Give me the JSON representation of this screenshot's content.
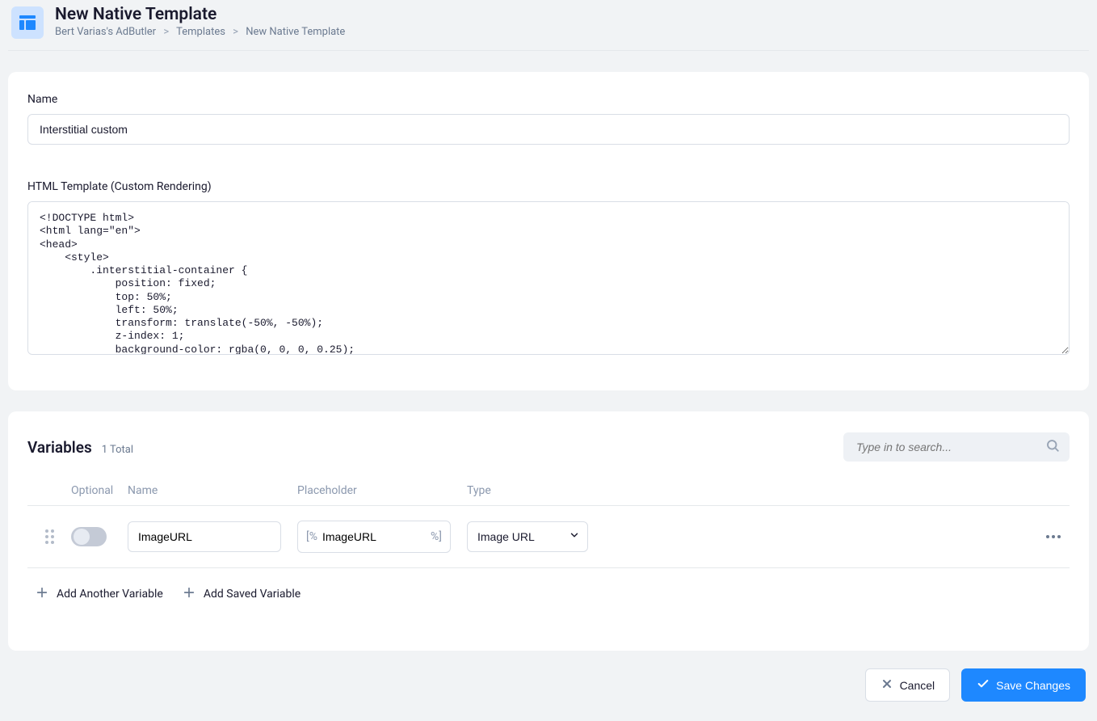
{
  "header": {
    "title": "New Native Template",
    "breadcrumb": {
      "item1": "Bert Varias's AdButler",
      "item2": "Templates",
      "item3": "New Native Template"
    }
  },
  "form": {
    "name_label": "Name",
    "name_value": "Interstitial custom",
    "html_label": "HTML Template (Custom Rendering)",
    "html_value": "<!DOCTYPE html>\n<html lang=\"en\">\n<head>\n    <style>\n        .interstitial-container {\n            position: fixed;\n            top: 50%;\n            left: 50%;\n            transform: translate(-50%, -50%);\n            z-index: 1;\n            background-color: rgba(0, 0, 0, 0.25);"
  },
  "variables": {
    "title": "Variables",
    "count_text": "1 Total",
    "search_placeholder": "Type in to search...",
    "columns": {
      "optional": "Optional",
      "name": "Name",
      "placeholder": "Placeholder",
      "type": "Type"
    },
    "rows": [
      {
        "name": "ImageURL",
        "placeholder": "ImageURL",
        "type": "Image URL",
        "prefix": "[%",
        "suffix": "%]"
      }
    ],
    "add_another": "Add Another Variable",
    "add_saved": "Add Saved Variable"
  },
  "footer": {
    "cancel": "Cancel",
    "save": "Save Changes"
  }
}
